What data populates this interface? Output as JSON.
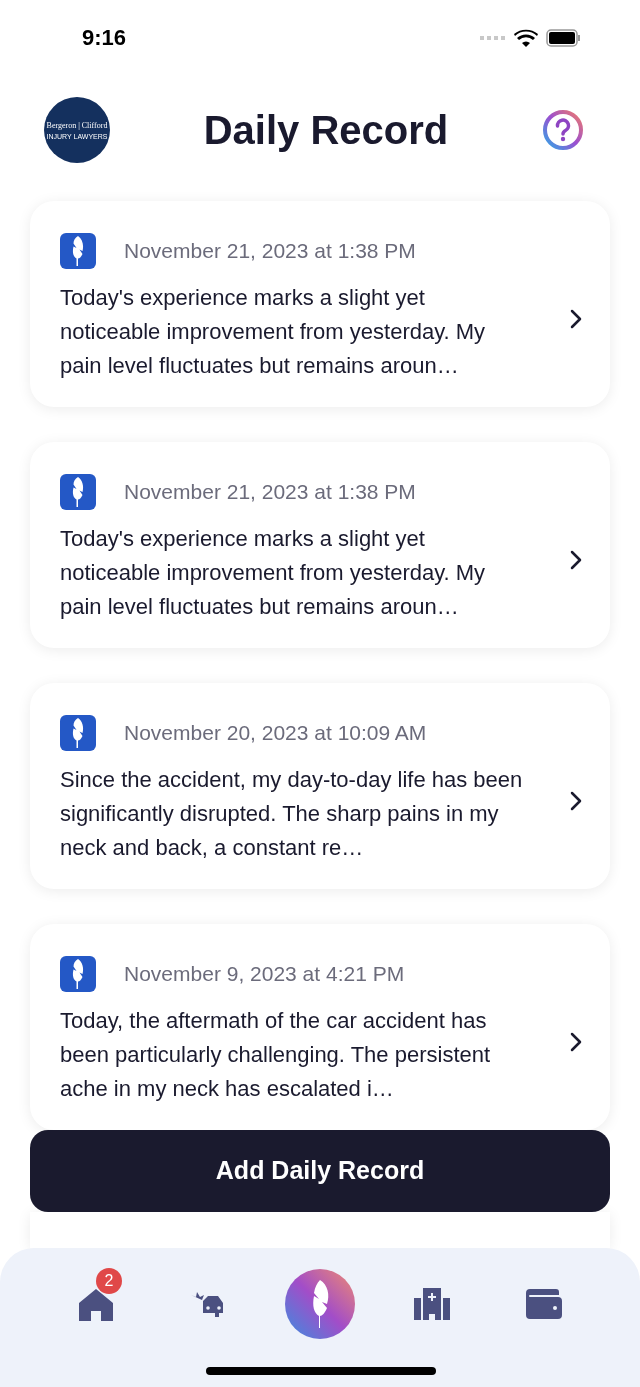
{
  "status_bar": {
    "time": "9:16"
  },
  "header": {
    "logo": {
      "name": "Bergeron | Clifford",
      "tagline": "INJURY LAWYERS"
    },
    "title": "Daily Record"
  },
  "records": [
    {
      "date": "November 21, 2023 at 1:38 PM",
      "text": "Today's experience marks a slight yet noticeable improvement from yesterday. My pain level fluctuates but remains aroun…"
    },
    {
      "date": "November 21, 2023 at 1:38 PM",
      "text": "Today's experience marks a slight yet noticeable improvement from yesterday. My pain level fluctuates but remains aroun…"
    },
    {
      "date": "November 20, 2023 at 10:09 AM",
      "text": "Since the accident, my day-to-day life has been significantly disrupted. The sharp pains in my neck and back, a constant re…"
    },
    {
      "date": "November 9, 2023 at 4:21 PM",
      "text": "Today, the aftermath of the car accident has been particularly challenging. The persistent ache in my neck has escalated i…"
    }
  ],
  "add_button": "Add Daily Record",
  "nav": [
    {
      "kind": "home",
      "badge": "2"
    },
    {
      "kind": "accident"
    },
    {
      "kind": "record"
    },
    {
      "kind": "hospital"
    },
    {
      "kind": "wallet"
    }
  ]
}
